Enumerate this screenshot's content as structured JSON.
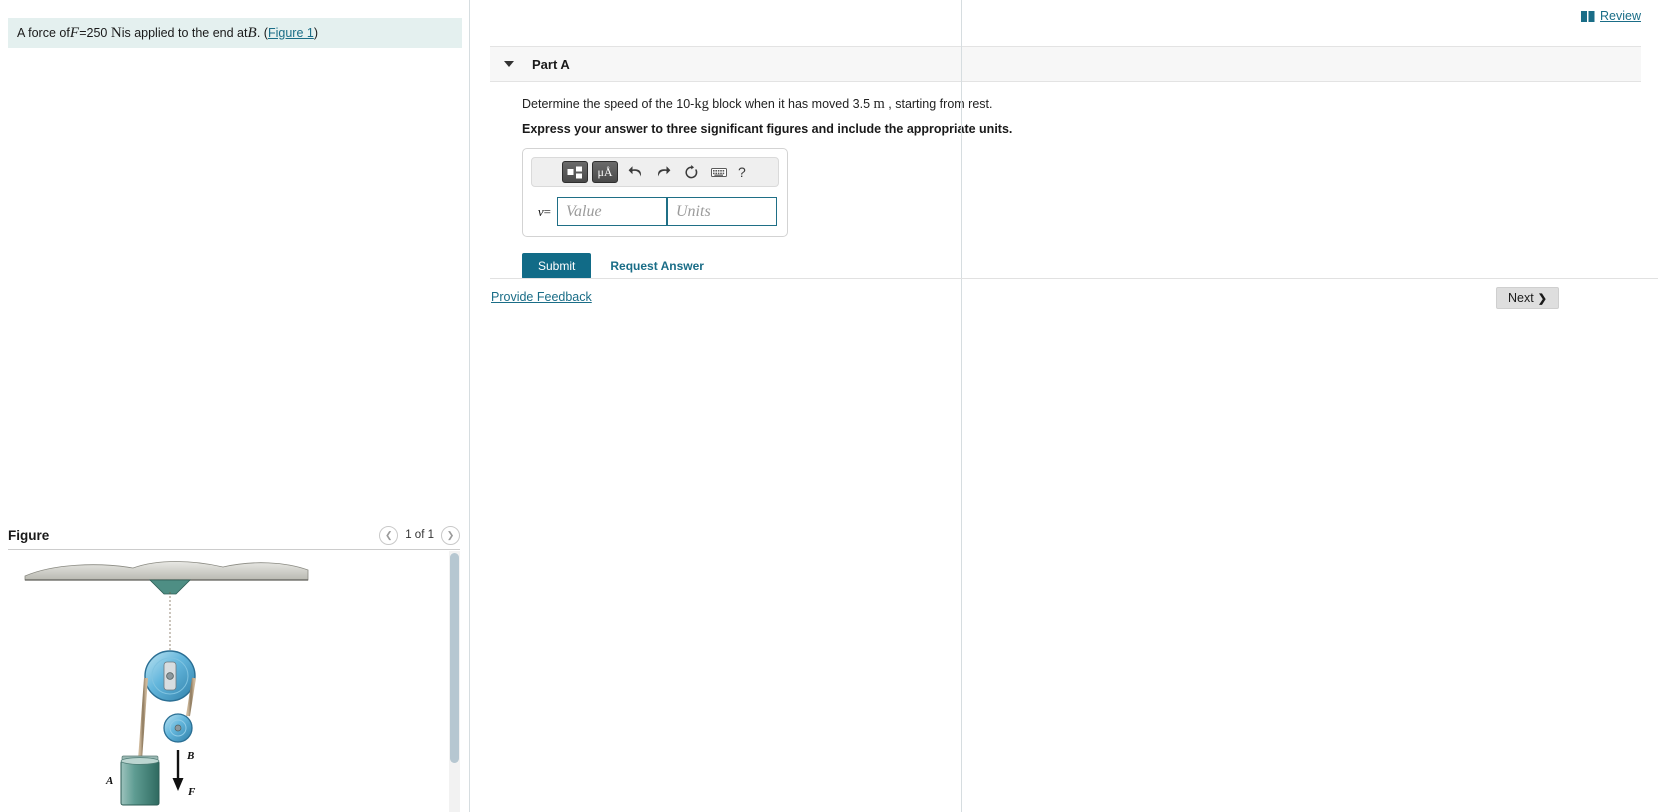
{
  "problem": {
    "text_before": "A force of ",
    "force_symbol": "F",
    "equals": " = ",
    "force_value": "250",
    "force_unit": "N",
    "text_middle": " is applied to the end at ",
    "point_label": "B",
    "period": ". (",
    "figure_link": "Figure 1",
    "close_paren": ")"
  },
  "figure": {
    "title": "Figure",
    "pager_label": "1 of 1",
    "prev_icon": "chevron-left-icon",
    "next_icon": "chevron-right-icon",
    "labels": {
      "point_b": "B",
      "force": "F",
      "block_a": "A"
    }
  },
  "header": {
    "review_label": "Review",
    "review_icon": "book-icon"
  },
  "part": {
    "collapse_icon": "caret-down-icon",
    "title": "Part A",
    "question_prefix": "Determine the speed of the 10-",
    "question_unit_mass": "kg",
    "question_middle": " block when it has moved 3.5 ",
    "question_unit_dist": "m",
    "question_suffix": " , starting from rest.",
    "instruction": "Express your answer to three significant figures and include the appropriate units."
  },
  "answer": {
    "variable": "v",
    "equals_sign": "=",
    "value_placeholder": "Value",
    "units_placeholder": "Units",
    "value_current": "",
    "units_current": "",
    "toolbar": {
      "template_icon": "math-template-icon",
      "units_icon": "μÅ",
      "undo_icon": "undo-arrow-icon",
      "redo_icon": "redo-arrow-icon",
      "reset_icon": "reset-circular-arrow-icon",
      "keyboard_icon": "keyboard-icon",
      "help_label": "?"
    }
  },
  "actions": {
    "submit_label": "Submit",
    "request_answer_label": "Request Answer",
    "feedback_label": "Provide Feedback",
    "next_label": "Next",
    "next_chevron": "❯"
  },
  "colors": {
    "accent_teal": "#116b87",
    "link_teal": "#1a6d87",
    "statement_bg": "#e4f0ef",
    "part_header_bg": "#f7f7f7",
    "next_btn_bg": "#dedede"
  }
}
